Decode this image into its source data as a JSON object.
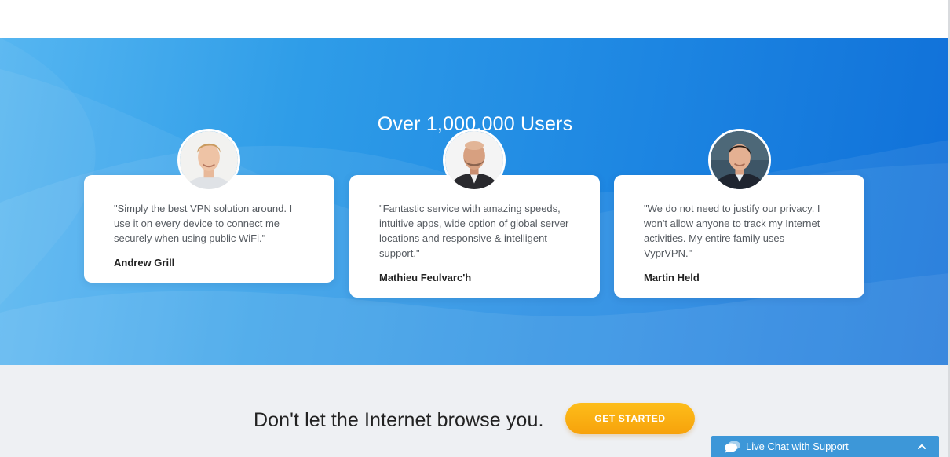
{
  "hero": {
    "title": "Over 1,000,000 Users"
  },
  "testimonials": [
    {
      "quote": "\"Simply the best VPN solution around. I use it on every device to connect me securely when using public WiFi.\"",
      "author": "Andrew Grill"
    },
    {
      "quote": "\"Fantastic service with amazing speeds, intuitive apps, wide option of global server locations and responsive & intelligent support.\"",
      "author": "Mathieu Feulvarc'h"
    },
    {
      "quote": "\"We do not need to justify our privacy. I won't allow anyone to track my Internet activities. My entire family uses VyprVPN.\"",
      "author": "Martin Held"
    }
  ],
  "cta_section": {
    "tagline": "Don't let the Internet browse you.",
    "button_label": "GET STARTED"
  },
  "chat": {
    "label": "Live Chat with Support",
    "icon": "chat-bubbles-icon",
    "toggle_icon": "chevron-up-icon"
  },
  "colors": {
    "hero_gradient_start": "#56b6f1",
    "hero_gradient_end": "#0f6fd8",
    "cta_orange": "#f9ab10",
    "chat_blue": "#3d97d8",
    "bottom_bg": "#eef0f3"
  }
}
